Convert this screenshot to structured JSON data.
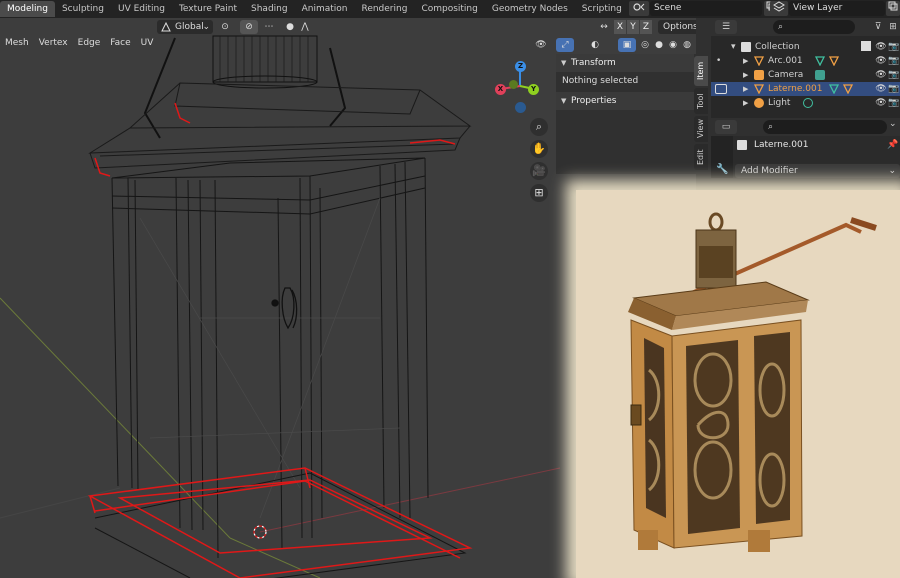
{
  "workspace_tabs": [
    "Modeling",
    "Sculpting",
    "UV Editing",
    "Texture Paint",
    "Shading",
    "Animation",
    "Rendering",
    "Compositing",
    "Geometry Nodes",
    "Scripting"
  ],
  "active_tab": "Modeling",
  "add_tab_symbol": "+",
  "scene": {
    "name": "Scene"
  },
  "view_layer": {
    "name": "View Layer"
  },
  "viewport_header": {
    "transform_orientation": "Global",
    "axes": [
      "X",
      "Y",
      "Z"
    ],
    "options_label": "Options"
  },
  "viewport_menu": [
    "Mesh",
    "Vertex",
    "Edge",
    "Face",
    "UV"
  ],
  "sidebar": {
    "transform_header": "Transform",
    "transform_text": "Nothing selected",
    "properties_header": "Properties",
    "tabs": [
      "Item",
      "Tool",
      "View",
      "Edit"
    ]
  },
  "outliner": {
    "rows": [
      {
        "label": "Collection",
        "icon": "collection-icon",
        "indent": 0,
        "selected": false
      },
      {
        "label": "Arc.001",
        "icon": "mesh-icon",
        "indent": 1,
        "selected": false
      },
      {
        "label": "Camera",
        "icon": "camera-icon",
        "indent": 1,
        "selected": false
      },
      {
        "label": "Laterne.001",
        "icon": "mesh-icon",
        "indent": 1,
        "selected": true
      },
      {
        "label": "Light",
        "icon": "light-icon",
        "indent": 1,
        "selected": false
      }
    ]
  },
  "properties": {
    "object_name": "Laterne.001",
    "add_modifier_label": "Add Modifier"
  },
  "colors": {
    "selection_blue": "#334d80",
    "active_orange": "#f0a045",
    "axis_x": "#e0405a",
    "axis_y": "#8fd020",
    "axis_z": "#3a8ee6",
    "edit_edge_red": "#ff2020"
  },
  "icons": [
    "search-icon",
    "filter-icon",
    "pin-icon",
    "hand-icon",
    "zoom-icon",
    "camera-view-icon",
    "grid-view-icon",
    "wrench-icon"
  ]
}
